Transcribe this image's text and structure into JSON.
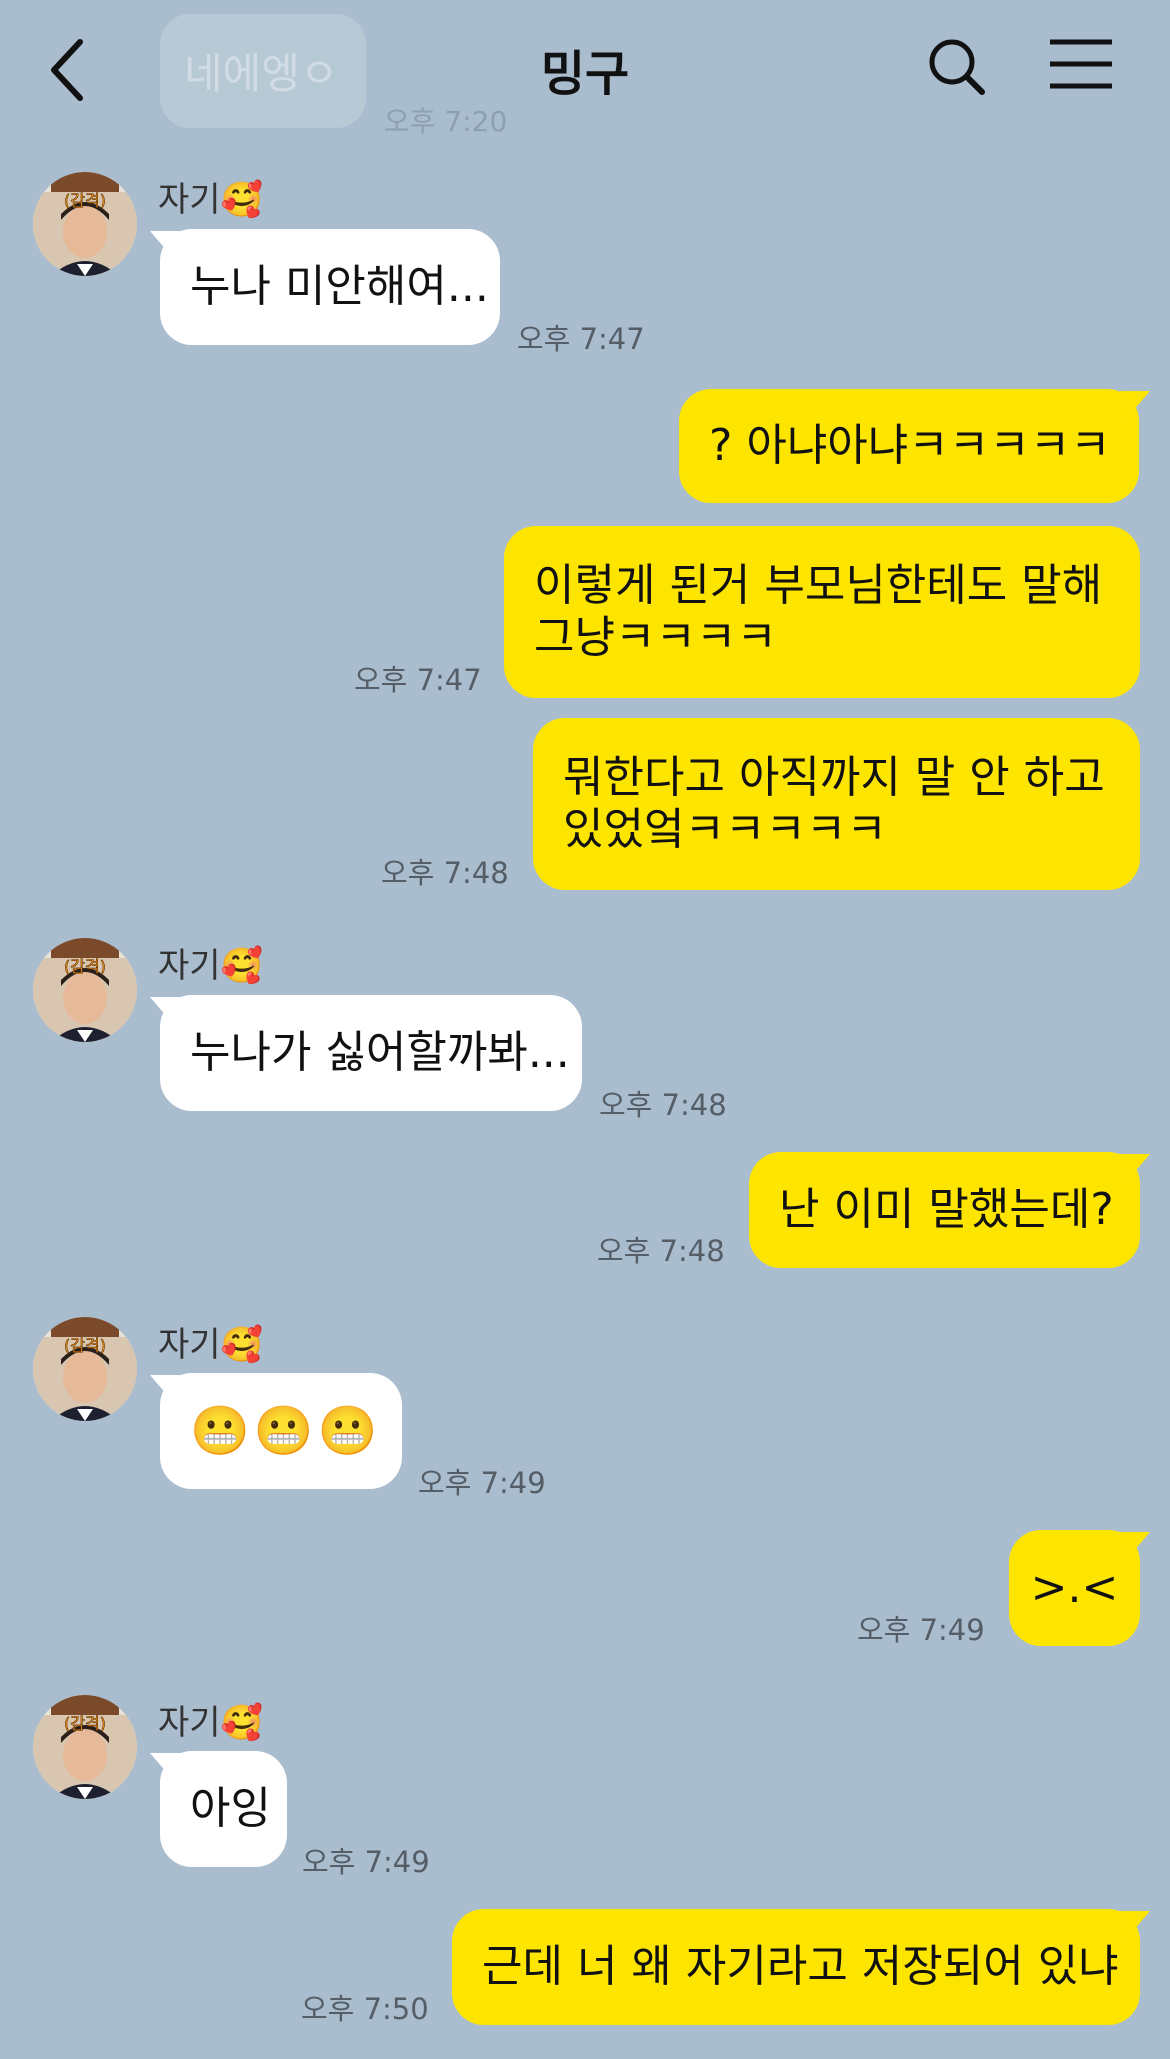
{
  "header": {
    "title": "밍구"
  },
  "ghost_message": {
    "text": "네에엥ㅇ",
    "time": "오후 7:20"
  },
  "messages": [
    {
      "sender": "자기🥰",
      "text": "누나 미안해여...",
      "time": "오후 7:47",
      "direction": "in"
    },
    {
      "text": "? 아냐아냐ㅋㅋㅋㅋㅋ",
      "direction": "out"
    },
    {
      "lines": [
        "이렇게 된거 부모님한테도 말해",
        "그냥ㅋㅋㅋㅋ"
      ],
      "time": "오후 7:47",
      "direction": "out"
    },
    {
      "lines": [
        "뭐한다고 아직까지 말 안 하고",
        "있었엌ㅋㅋㅋㅋㅋ"
      ],
      "time": "오후 7:48",
      "direction": "out"
    },
    {
      "sender": "자기🥰",
      "text": "누나가 싫어할까봐...",
      "time": "오후 7:48",
      "direction": "in"
    },
    {
      "text": "난 이미 말했는데?",
      "time": "오후 7:48",
      "direction": "out"
    },
    {
      "sender": "자기🥰",
      "text": "😬😬😬",
      "time": "오후 7:49",
      "direction": "in"
    },
    {
      "text": ">.<",
      "time": "오후 7:49",
      "direction": "out"
    },
    {
      "sender": "자기🥰",
      "text": "아잉",
      "time": "오후 7:49",
      "direction": "in"
    },
    {
      "text": "근데 너 왜 자기라고 저장되어 있냐",
      "time": "오후 7:50",
      "direction": "out"
    }
  ],
  "avatar_badge": "(감격)",
  "icons": [
    "back-arrow-icon",
    "search-icon",
    "menu-icon"
  ],
  "colors": {
    "background": "#a9bdce",
    "outgoing_bubble": "#fee500",
    "incoming_bubble": "#ffffff"
  }
}
